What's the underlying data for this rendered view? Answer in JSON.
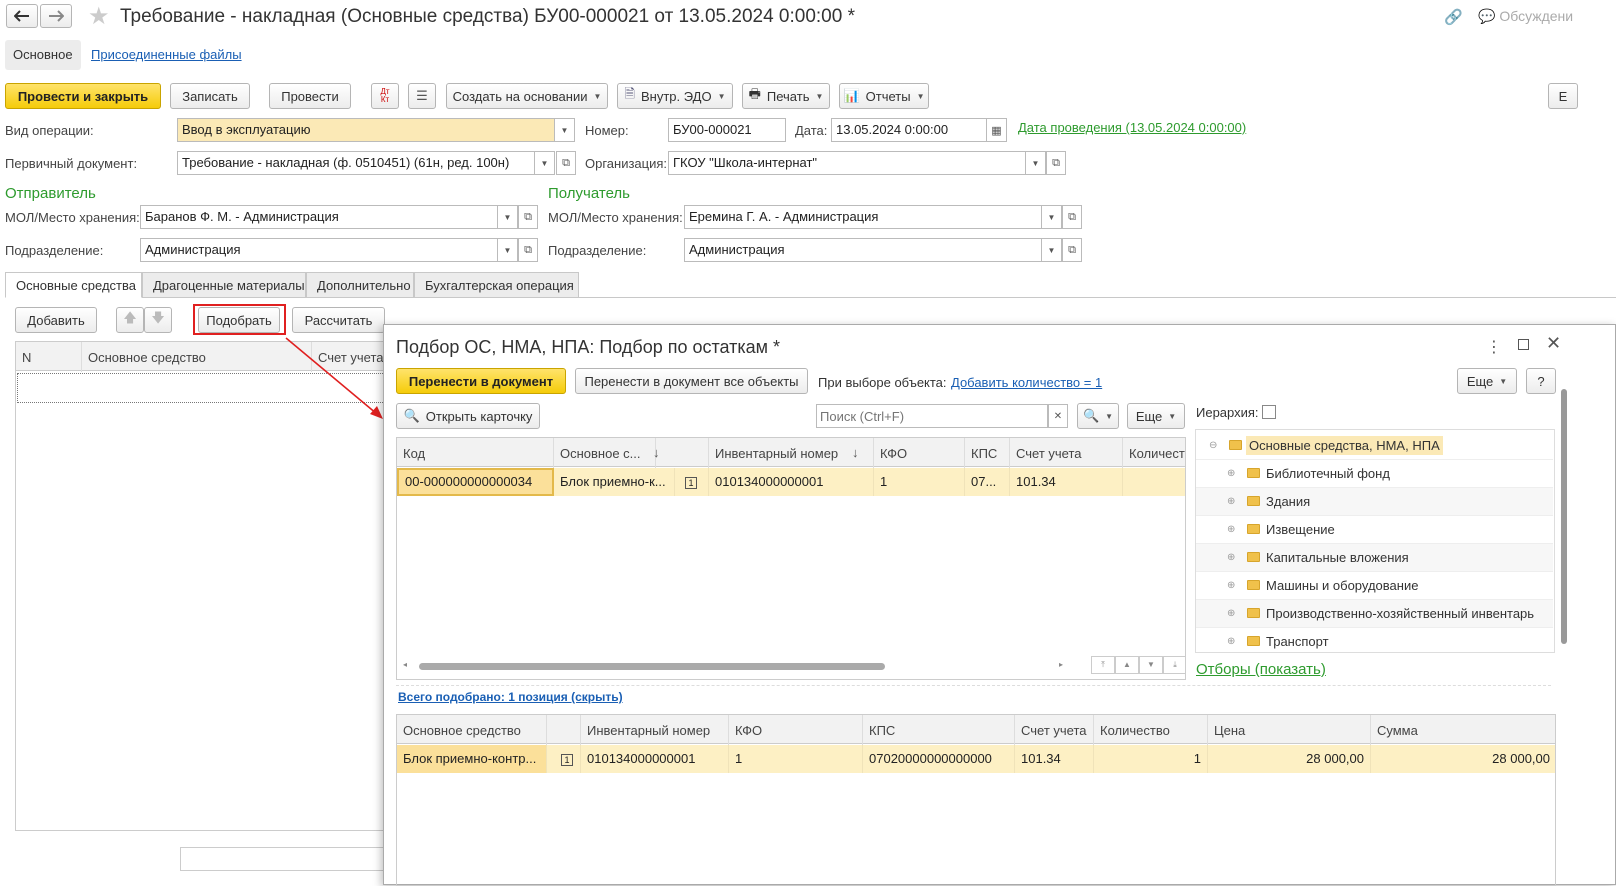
{
  "window": {
    "title": "Требование - накладная (Основные средства) БУ00-000021 от 13.05.2024 0:00:00 *",
    "discuss_label": "Обсуждени"
  },
  "nav_tabs": {
    "main": "Основное",
    "files": "Присоединенные файлы"
  },
  "toolbar": {
    "post_close": "Провести и закрыть",
    "save": "Записать",
    "post": "Провести",
    "dtkt": "Дт Кт",
    "create_based": "Создать на основании",
    "edo": "Внутр. ЭДО",
    "print": "Печать",
    "reports": "Отчеты",
    "more_right": "Е"
  },
  "form": {
    "op_type_label": "Вид операции:",
    "op_type_value": "Ввод в эксплуатацию",
    "number_label": "Номер:",
    "number_value": "БУ00-000021",
    "date_label": "Дата:",
    "date_value": "13.05.2024  0:00:00",
    "posting_date_link": "Дата проведения (13.05.2024 0:00:00)",
    "primary_doc_label": "Первичный документ:",
    "primary_doc_value": "Требование - накладная (ф. 0510451) (61н, ред. 100н)",
    "org_label": "Организация:",
    "org_value": "ГКОУ \"Школа-интернат\""
  },
  "sender": {
    "title": "Отправитель",
    "mol_label": "МОЛ/Место хранения:",
    "mol_value": "Баранов Ф. М. - Администрация",
    "dept_label": "Подразделение:",
    "dept_value": "Администрация"
  },
  "receiver": {
    "title": "Получатель",
    "mol_label": "МОЛ/Место хранения:",
    "mol_value": "Еремина Г. А. - Администрация",
    "dept_label": "Подразделение:",
    "dept_value": "Администрация"
  },
  "doc_tabs": [
    "Основные средства",
    "Драгоценные материалы",
    "Дополнительно",
    "Бухгалтерская операция"
  ],
  "table_toolbar": {
    "add": "Добавить",
    "pick": "Подобрать",
    "calc": "Рассчитать"
  },
  "main_table": {
    "columns": [
      "N",
      "Основное средство",
      "Счет учета"
    ]
  },
  "dialog": {
    "title": "Подбор ОС, НМА, НПА: Подбор по остаткам *",
    "transfer": "Перенести в документ",
    "transfer_all": "Перенести в документ все объекты",
    "on_select_label": "При выборе объекта:",
    "add_qty_link": "Добавить количество = 1",
    "more": "Еще",
    "help": "?",
    "open_card": "Открыть карточку",
    "search_placeholder": "Поиск (Ctrl+F)",
    "more2": "Еще",
    "hierarchy_label": "Иерархия:",
    "upper_columns": [
      "Код",
      "Основное с...",
      "",
      "Инвентарный номер",
      "КФО",
      "КПС",
      "Счет учета",
      "Количест"
    ],
    "upper_row": [
      "00-000000000000034",
      "Блок приемно-к...",
      "1",
      "010134000000001",
      "1",
      "07...",
      "101.34",
      ""
    ],
    "tree_root": "Основные средства, НМА, НПА",
    "tree_items": [
      "Библиотечный фонд",
      "Здания",
      "Извещение",
      "Капитальные вложения",
      "Машины и оборудование",
      "Производственно-хозяйственный инвентарь",
      "Транспорт"
    ],
    "filters_link": "Отборы (показать)",
    "total_link": "Всего подобрано: 1 позиция (скрыть)",
    "lower_columns": [
      "Основное средство",
      "",
      "Инвентарный номер",
      "КФО",
      "КПС",
      "Счет учета",
      "Количество",
      "Цена",
      "Сумма"
    ],
    "lower_row": [
      "Блок приемно-контр...",
      "1",
      "010134000000001",
      "1",
      "07020000000000000",
      "101.34",
      "1",
      "28 000,00",
      "28 000,00"
    ]
  },
  "colors": {
    "accent_yellow": "#f5cc0a",
    "green": "#2e9b2e",
    "link": "#1a5fb4",
    "highlight": "#fdf0c4",
    "red_arrow": "#e02020"
  }
}
